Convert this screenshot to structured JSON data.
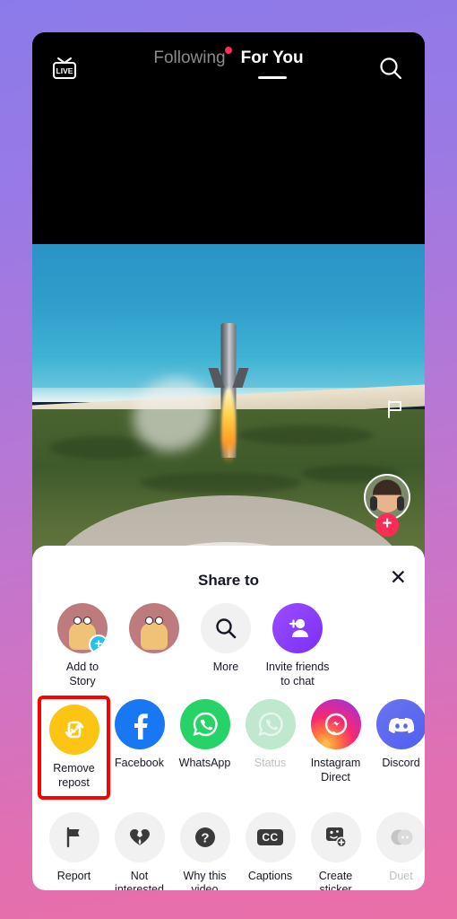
{
  "topnav": {
    "live_label": "LIVE",
    "following_label": "Following",
    "foryou_label": "For You",
    "search_icon": "search-icon"
  },
  "video": {
    "flag_icon": "flag-icon",
    "follow_plus": "+",
    "heart_icon": "heart-icon"
  },
  "sheet": {
    "title": "Share to",
    "close_label": "✕",
    "row1": [
      {
        "label": "Add to\nStory",
        "icon": "avatar-story-icon",
        "disabled": false
      },
      {
        "label": "",
        "icon": "avatar-icon",
        "disabled": false
      },
      {
        "label": "More",
        "icon": "search-icon",
        "disabled": false
      },
      {
        "label": "Invite friends\nto chat",
        "icon": "add-person-icon",
        "disabled": false
      }
    ],
    "row2": [
      {
        "label": "Remove\nrepost",
        "icon": "repost-icon",
        "disabled": false,
        "highlighted": true
      },
      {
        "label": "Facebook",
        "icon": "facebook-icon",
        "disabled": false
      },
      {
        "label": "WhatsApp",
        "icon": "whatsapp-icon",
        "disabled": false
      },
      {
        "label": "Status",
        "icon": "whatsapp-status-icon",
        "disabled": true
      },
      {
        "label": "Instagram\nDirect",
        "icon": "instagram-direct-icon",
        "disabled": false
      },
      {
        "label": "Discord",
        "icon": "discord-icon",
        "disabled": false
      }
    ],
    "row3": [
      {
        "label": "Report",
        "icon": "flag-icon",
        "disabled": false
      },
      {
        "label": "Not\ninterested",
        "icon": "broken-heart-icon",
        "disabled": false
      },
      {
        "label": "Why this\nvideo",
        "icon": "question-icon",
        "disabled": false
      },
      {
        "label": "Captions",
        "icon": "captions-icon",
        "disabled": false
      },
      {
        "label": "Create\nsticker",
        "icon": "create-sticker-icon",
        "disabled": false
      },
      {
        "label": "Duet",
        "icon": "duet-icon",
        "disabled": true
      }
    ]
  },
  "colors": {
    "accent_red": "#fe2c55",
    "repost_yellow": "#fdc513",
    "facebook_blue": "#1877f2",
    "whatsapp_green": "#25d366",
    "discord_blurple": "#5865f2",
    "highlight_box": "#ff0000"
  }
}
